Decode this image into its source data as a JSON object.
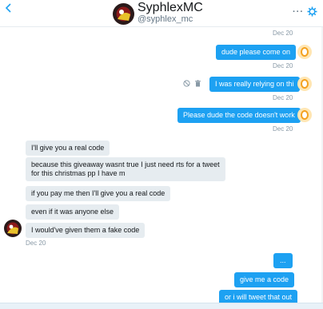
{
  "header": {
    "name": "SyphlexMC",
    "handle": "@syphlex_mc",
    "more_icon": "···"
  },
  "colors": {
    "outgoing_bubble": "#1da1f2",
    "incoming_bubble": "#e6ecf0",
    "avatar_ring": "#f4a11f"
  },
  "messages": [
    {
      "direction": "date",
      "text": "Dec 20"
    },
    {
      "direction": "out",
      "text": "dude please come on",
      "time": "Dec 20"
    },
    {
      "direction": "out",
      "text": "I was really relying on thi",
      "time": "Dec 20"
    },
    {
      "direction": "out",
      "text": "Please dude the code doesn't work",
      "time": "Dec 20"
    },
    {
      "direction": "in",
      "text": "I'll give you a real code"
    },
    {
      "direction": "in",
      "text": "because this giveaway wasnt true I just need rts for a tweet\nfor this christmas pp I have m"
    },
    {
      "direction": "in",
      "text": "if you pay me then I'll give you a real code"
    },
    {
      "direction": "in",
      "text": "even if it was anyone else"
    },
    {
      "direction": "in",
      "text": "I would've given them a fake code",
      "time": "Dec 20"
    },
    {
      "direction": "out",
      "text": "..."
    },
    {
      "direction": "out",
      "text": "give me a code"
    },
    {
      "direction": "out",
      "text": "or i will tweet that out"
    }
  ]
}
